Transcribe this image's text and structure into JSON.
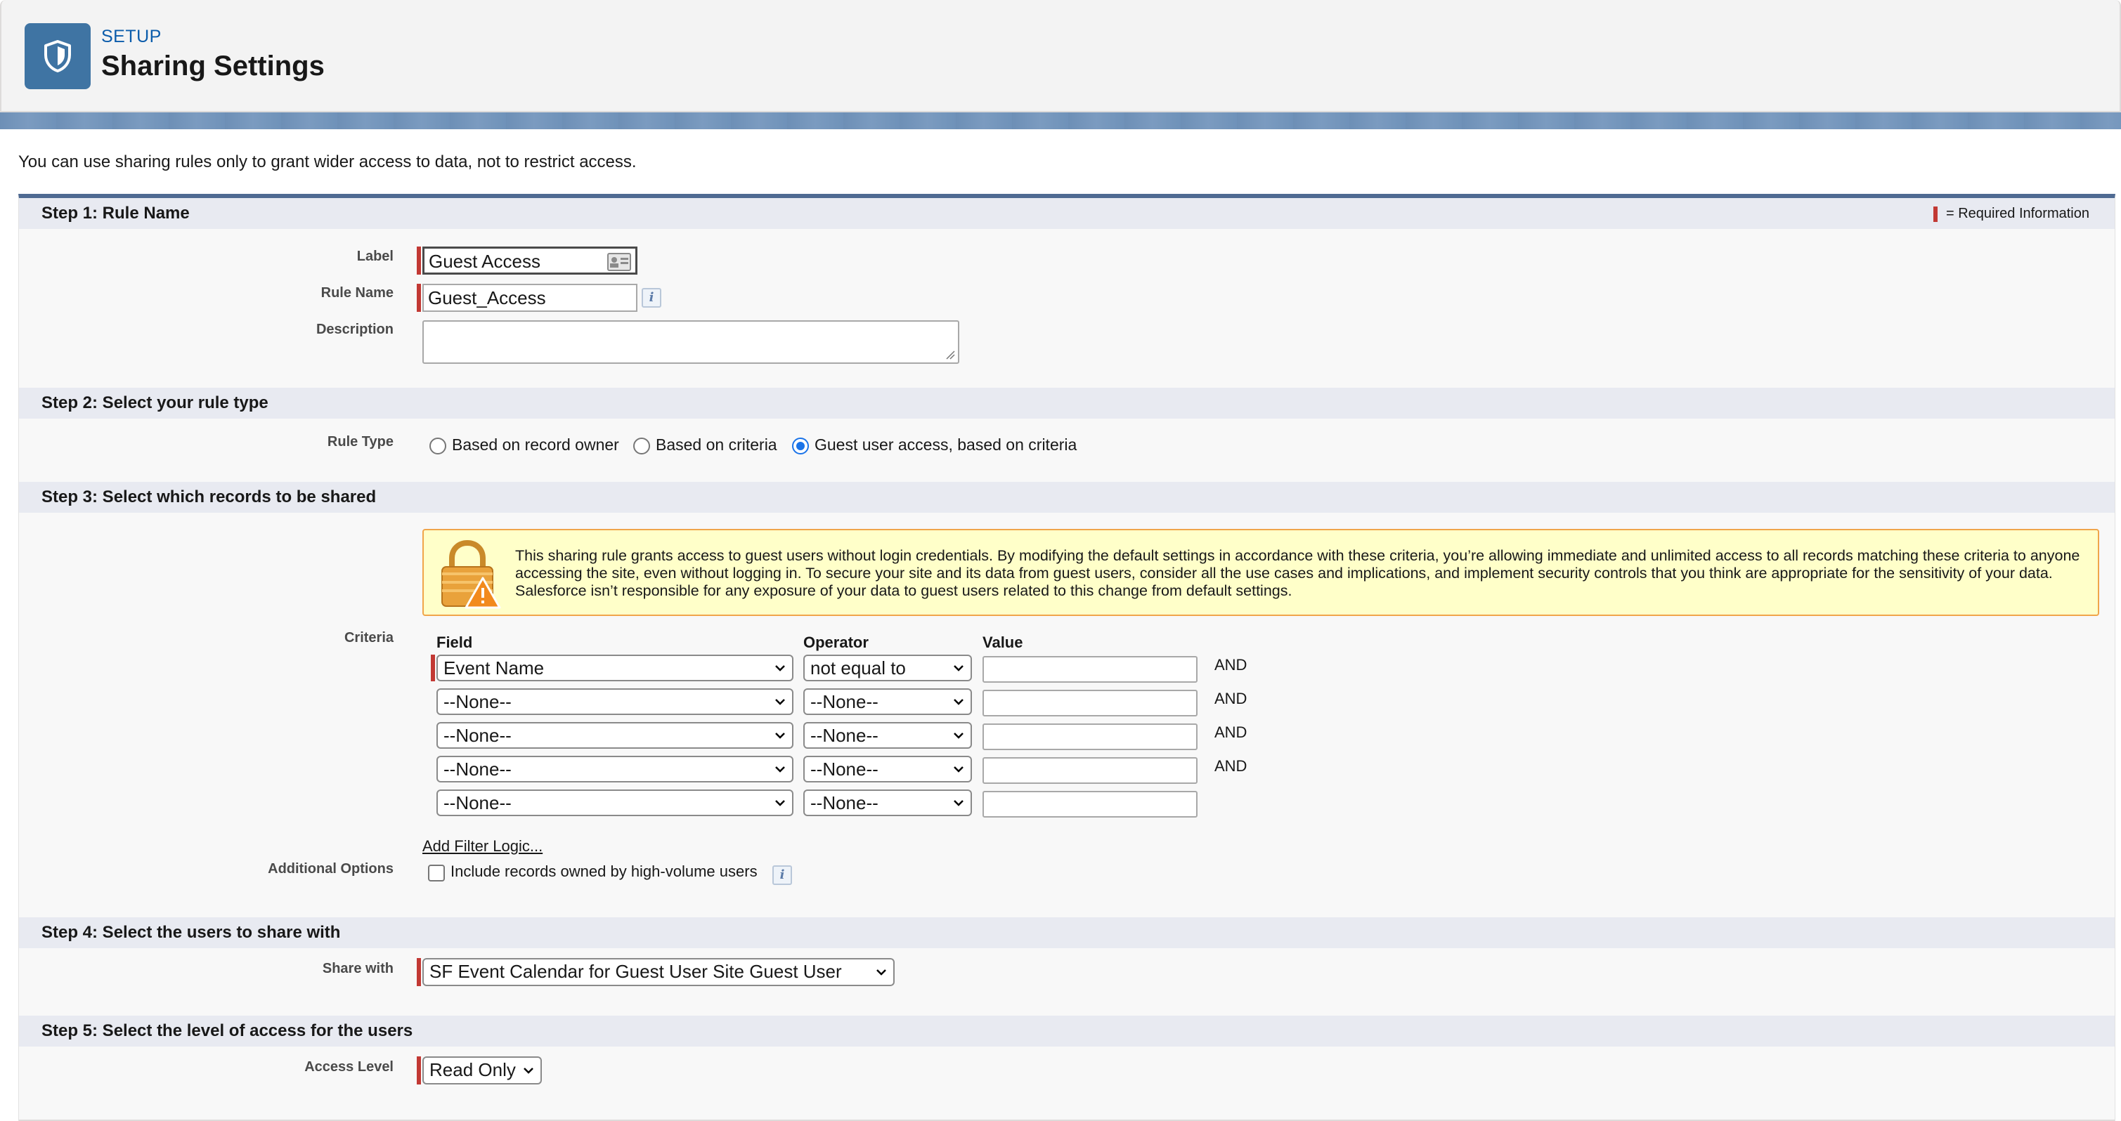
{
  "header": {
    "eyebrow": "SETUP",
    "title": "Sharing Settings",
    "icon": "shield-icon"
  },
  "intro_text": "You can use sharing rules only to grant wider access to data, not to restrict access.",
  "required_legend": "= Required Information",
  "colors": {
    "brand": "#3f74a3",
    "required": "#c23934",
    "warning_bg": "#ffffc9",
    "radio_selected": "#1a73e8"
  },
  "step1": {
    "title": "Step 1: Rule Name",
    "label_label": "Label",
    "label_value": "Guest Access",
    "rule_name_label": "Rule Name",
    "rule_name_value": "Guest_Access",
    "description_label": "Description",
    "description_value": ""
  },
  "step2": {
    "title": "Step 2: Select your rule type",
    "rule_type_label": "Rule Type",
    "options": [
      "Based on record owner",
      "Based on criteria",
      "Guest user access, based on criteria"
    ],
    "selected": "Guest user access, based on criteria"
  },
  "step3": {
    "title": "Step 3: Select which records to be shared",
    "warning": "This sharing rule grants access to guest users without login credentials. By modifying the default settings in accordance with these criteria, you’re allowing immediate and unlimited access to all records matching these criteria to anyone accessing the site, even without logging in. To secure your site and its data from guest users, consider all the use cases and implications, and implement security controls that you think are appropriate for the sensitivity of your data. Salesforce isn’t responsible for any exposure of your data to guest users related to this change from default settings.",
    "criteria_label": "Criteria",
    "columns": {
      "field": "Field",
      "operator": "Operator",
      "value": "Value"
    },
    "rows": [
      {
        "field": "Event Name",
        "operator": "not equal to",
        "value": "",
        "conj": "AND"
      },
      {
        "field": "--None--",
        "operator": "--None--",
        "value": "",
        "conj": "AND"
      },
      {
        "field": "--None--",
        "operator": "--None--",
        "value": "",
        "conj": "AND"
      },
      {
        "field": "--None--",
        "operator": "--None--",
        "value": "",
        "conj": "AND"
      },
      {
        "field": "--None--",
        "operator": "--None--",
        "value": "",
        "conj": ""
      }
    ],
    "add_filter_logic": "Add Filter Logic...",
    "additional_options_label": "Additional Options",
    "high_volume_label": "Include records owned by high-volume users",
    "high_volume_checked": false
  },
  "step4": {
    "title": "Step 4: Select the users to share with",
    "share_with_label": "Share with",
    "share_with_value": "SF Event Calendar for Guest User Site Guest User"
  },
  "step5": {
    "title": "Step 5: Select the level of access for the users",
    "access_level_label": "Access Level",
    "access_level_value": "Read Only"
  }
}
